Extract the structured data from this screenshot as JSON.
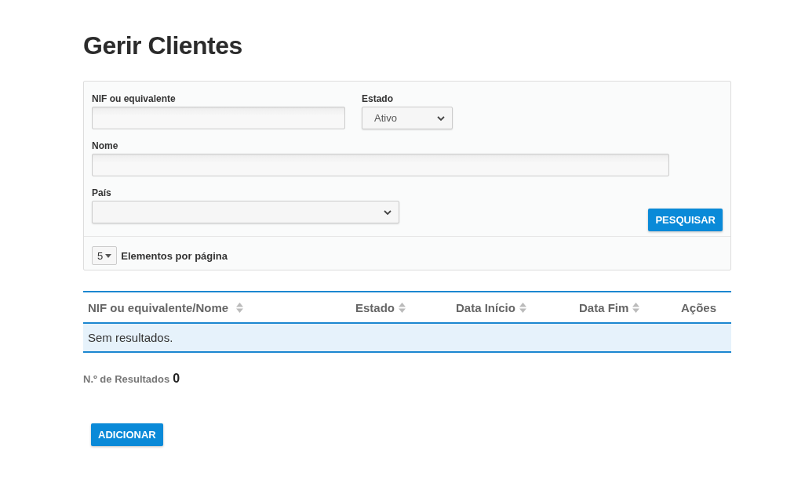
{
  "page_title": "Gerir Clientes",
  "filters": {
    "nif": {
      "label": "NIF ou equivalente"
    },
    "estado": {
      "label": "Estado",
      "value": "Ativo"
    },
    "nome": {
      "label": "Nome"
    },
    "pais": {
      "label": "País"
    },
    "search_button": "PESQUISAR"
  },
  "page_size": {
    "value": "5",
    "label": "Elementos por página"
  },
  "table": {
    "columns": [
      {
        "label": "NIF ou equivalente/Nome",
        "sortable": true
      },
      {
        "label": "Estado",
        "sortable": true
      },
      {
        "label": "Data Início",
        "sortable": true
      },
      {
        "label": "Data Fim",
        "sortable": true
      },
      {
        "label": "Ações",
        "sortable": false
      }
    ],
    "empty_message": "Sem resultados."
  },
  "results": {
    "label": "N.º de Resultados",
    "count": "0"
  },
  "add_button": "ADICIONAR"
}
